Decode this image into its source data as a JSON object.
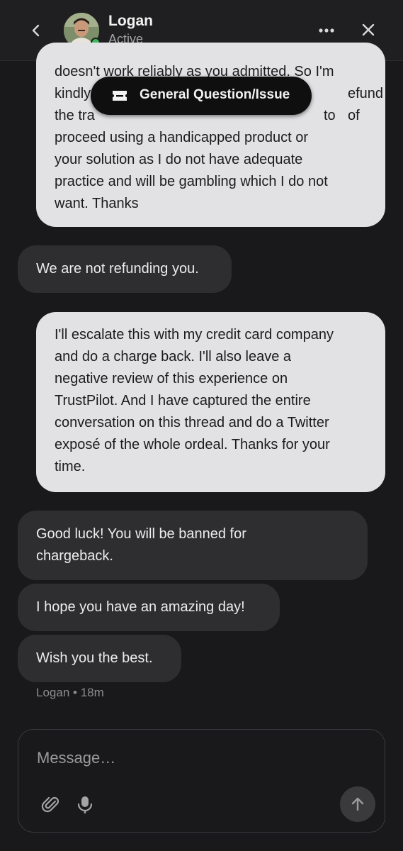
{
  "header": {
    "agent_name": "Logan",
    "agent_status": "Active",
    "icons": {
      "back": "chevron-left-icon",
      "more": "more-horizontal-icon",
      "close": "close-icon"
    },
    "status_color": "#3cb95a"
  },
  "topic": {
    "label": "General Question/Issue",
    "icon": "ticket-icon"
  },
  "messages": [
    {
      "sender": "user",
      "lines": [
        "doesn't work reliably as you admitted. So I'm",
        "kindly",
        "efund of",
        "the tra",
        "to",
        "proceed using a handicapped product or",
        "your solution as I do not have adequate",
        "practice and will be gambling which I do not",
        "want. Thanks"
      ]
    },
    {
      "sender": "agent",
      "text": "We are not refunding you."
    },
    {
      "sender": "user",
      "lines": [
        "I'll escalate this with my credit card company",
        "and do a charge back. I'll also leave a",
        "negative review of this experience on",
        "TrustPilot. And I have captured the entire",
        "conversation on this thread and do a Twitter",
        "exposé of the whole ordeal. Thanks for your",
        "time."
      ]
    },
    {
      "sender": "agent",
      "lines": [
        "Good luck! You will be banned for",
        "chargeback."
      ]
    },
    {
      "sender": "agent",
      "text": "I hope you have an amazing day!"
    },
    {
      "sender": "agent",
      "text": "Wish you the best."
    }
  ],
  "meta": {
    "sender": "Logan",
    "separator": "•",
    "time": "18m"
  },
  "composer": {
    "placeholder": "Message…",
    "icons": {
      "attach": "paperclip-icon",
      "mic": "microphone-icon",
      "send": "arrow-up-icon"
    }
  },
  "colors": {
    "background": "#19191b",
    "user_bubble": "#e2e2e4",
    "agent_bubble": "#2e2e31",
    "topic_pill": "#0f0f10"
  }
}
